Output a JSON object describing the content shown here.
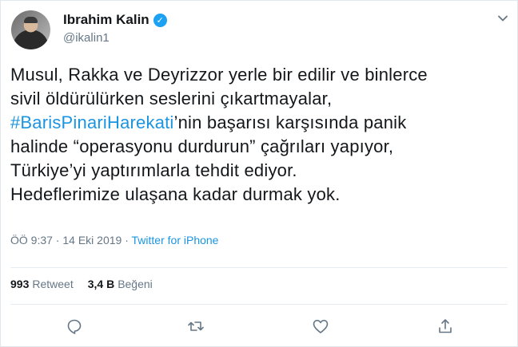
{
  "user": {
    "name": "Ibrahim Kalin",
    "handle": "@ikalin1",
    "verified": true
  },
  "tweet": {
    "lines": [
      "Musul, Rakka ve Deyrizzor yerle bir edilir ve binlerce",
      "sivil öldürülürken seslerini çıkartmayalar,",
      "halinde “operasyonu durdurun” çağrıları yapıyor,",
      "Türkiye’yi yaptırımlarla tehdit ediyor.",
      "Hedeflerimize ulaşana kadar durmak yok."
    ],
    "hashtag": "#BarisPinariHarekati",
    "hashtag_suffix": "’nin başarısı karşısında panik"
  },
  "meta": {
    "time": "ÖÖ 9:37",
    "separator": " · ",
    "date": "14 Eki 2019",
    "source": "Twitter for iPhone"
  },
  "stats": {
    "retweets_count": "993",
    "retweets_label": "Retweet",
    "likes_count": "3,4 B",
    "likes_label": "Beğeni"
  },
  "icons": {
    "reply": "reply-icon",
    "retweet": "retweet-icon",
    "like": "heart-icon",
    "share": "share-icon",
    "more": "chevron-down-icon",
    "verified": "verified-badge-icon"
  },
  "colors": {
    "accent": "#1da1f2",
    "link": "#1b95e0",
    "muted": "#657786",
    "text": "#14171a"
  }
}
